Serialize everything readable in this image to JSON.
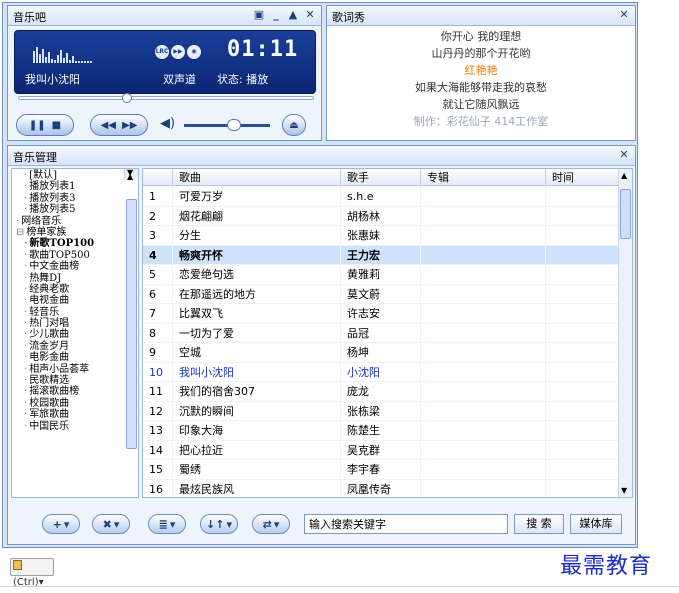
{
  "player": {
    "title": "音乐吧",
    "window_buttons": [
      "▣",
      "_",
      "▲",
      "✕"
    ],
    "song": "我叫小沈阳",
    "channel": "双声道",
    "status": "状态: 播放",
    "time": "01:11",
    "lcd_icons": [
      "LRC",
      "▶▶",
      "◉"
    ],
    "seek_progress": 0.36,
    "volume_level": 0.6
  },
  "lyrics": {
    "title": "歌词秀",
    "lines": [
      "你开心 我的理想",
      "山丹丹的那个开花哟",
      "红艳艳",
      "如果大海能够带走我的哀愁",
      "就让它随风飘远",
      "制作：彩花仙子 414工作室"
    ],
    "highlight_index": 2,
    "highlight_color": "#f07a00"
  },
  "manager": {
    "title": "音乐管理",
    "tree": [
      "[默认]",
      "播放列表1",
      "播放列表3",
      "播放列表5",
      "网络音乐",
      "榜单家族",
      "新歌TOP100",
      "歌曲TOP500",
      "中文金曲榜",
      "热舞DJ",
      "经典老歌",
      "电视金曲",
      "轻音乐",
      "热门对唱",
      "少儿歌曲",
      "流金岁月",
      "电影金曲",
      "相声小品荟萃",
      "民歌精选",
      "摇滚歌曲榜",
      "校园歌曲",
      "军旅歌曲",
      "中国民乐"
    ],
    "tree_selected": 6,
    "columns": [
      "",
      "歌曲",
      "歌手",
      "专辑",
      "时间"
    ],
    "rows": [
      {
        "n": "1",
        "song": "可爱万岁",
        "artist": "s.h.e"
      },
      {
        "n": "2",
        "song": "烟花翩翩",
        "artist": "胡杨林"
      },
      {
        "n": "3",
        "song": "分生",
        "artist": "张惠妹"
      },
      {
        "n": "4",
        "song": "畅爽开怀",
        "artist": "王力宏"
      },
      {
        "n": "5",
        "song": "恋爱绝句选",
        "artist": "黄雅莉"
      },
      {
        "n": "6",
        "song": "在那遥远的地方",
        "artist": "莫文蔚"
      },
      {
        "n": "7",
        "song": "比翼双飞",
        "artist": "许志安"
      },
      {
        "n": "8",
        "song": "一切为了爱",
        "artist": "品冠"
      },
      {
        "n": "9",
        "song": "空城",
        "artist": "杨坤"
      },
      {
        "n": "10",
        "song": "我叫小沈阳",
        "artist": "小沈阳"
      },
      {
        "n": "11",
        "song": "我们的宿舍307",
        "artist": "庞龙"
      },
      {
        "n": "12",
        "song": "沉默的瞬间",
        "artist": "张栋梁"
      },
      {
        "n": "13",
        "song": "印象大海",
        "artist": "陈楚生"
      },
      {
        "n": "14",
        "song": "把心拉近",
        "artist": "吴克群"
      },
      {
        "n": "15",
        "song": "蜀绣",
        "artist": "李宇春"
      },
      {
        "n": "16",
        "song": "最炫民族风",
        "artist": "凤凰传奇"
      }
    ],
    "selected_row": 3,
    "playing_row": 9,
    "toolbar": {
      "add": "+",
      "delete": "✖",
      "list": "≣",
      "sort": "↓↑",
      "mode": "⇄",
      "search_placeholder": "输入搜索关键字",
      "search_button": "搜 索",
      "media_button": "媒体库"
    }
  },
  "clipboard_label": "(Ctrl)",
  "watermark": "最需教育"
}
